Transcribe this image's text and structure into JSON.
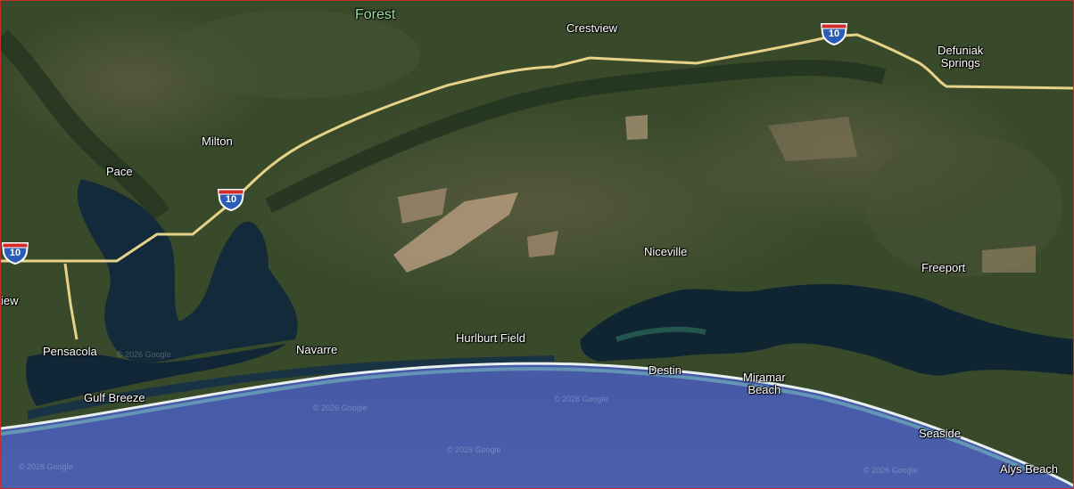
{
  "map": {
    "type": "satellite",
    "colors": {
      "ocean": "#4a5faa",
      "bay": "#132a3a",
      "land": "#3a4a2c",
      "highway": "#e7d28a",
      "clearing": "#b49a7c",
      "area_label": "#9fe29c"
    },
    "labels": {
      "forest": "Forest",
      "crestview": "Crestview",
      "defuniak": [
        "Defuniak",
        "Springs"
      ],
      "milton": "Milton",
      "pace": "Pace",
      "view": "iew",
      "pensacola": "Pensacola",
      "gulf_breeze": "Gulf Breeze",
      "navarre": "Navarre",
      "hurlburt": "Hurlburt Field",
      "niceville": "Niceville",
      "destin": "Destin",
      "miramar": [
        "Miramar",
        "Beach"
      ],
      "freeport": "Freeport",
      "seaside": "Seaside",
      "alys": "Alys Beach"
    },
    "interstate": "10",
    "watermark": "© 2026 Google"
  }
}
